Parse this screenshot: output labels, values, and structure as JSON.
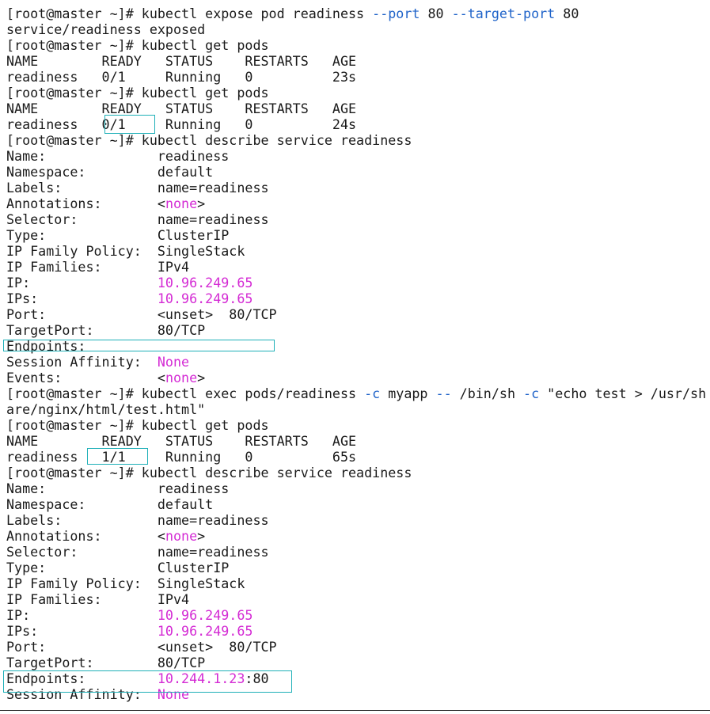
{
  "terminal": {
    "prompt": "[root@master ~]# ",
    "lines": [
      {
        "segments": [
          {
            "t": "[root@master ~]# kubectl expose pod readiness ",
            "c": ""
          },
          {
            "t": "--port",
            "c": "flag"
          },
          {
            "t": " 80 ",
            "c": ""
          },
          {
            "t": "--target-port",
            "c": "flag"
          },
          {
            "t": " 80",
            "c": ""
          }
        ]
      },
      {
        "segments": [
          {
            "t": "service/readiness exposed",
            "c": ""
          }
        ]
      },
      {
        "segments": [
          {
            "t": "[root@master ~]# kubectl get pods",
            "c": ""
          }
        ]
      },
      {
        "segments": [
          {
            "t": "NAME        READY   STATUS    RESTARTS   AGE",
            "c": ""
          }
        ]
      },
      {
        "segments": [
          {
            "t": "readiness   0/1     Running   0          23s",
            "c": ""
          }
        ]
      },
      {
        "segments": [
          {
            "t": "[root@master ~]# kubectl get pods",
            "c": ""
          }
        ]
      },
      {
        "segments": [
          {
            "t": "NAME        READY   STATUS    RESTARTS   AGE",
            "c": ""
          }
        ]
      },
      {
        "segments": [
          {
            "t": "readiness   0/1     Running   0          24s",
            "c": ""
          }
        ]
      },
      {
        "segments": [
          {
            "t": "[root@master ~]# kubectl describe service readiness",
            "c": ""
          }
        ]
      },
      {
        "segments": [
          {
            "t": "Name:              readiness",
            "c": ""
          }
        ]
      },
      {
        "segments": [
          {
            "t": "Namespace:         default",
            "c": ""
          }
        ]
      },
      {
        "segments": [
          {
            "t": "Labels:            name=readiness",
            "c": ""
          }
        ]
      },
      {
        "segments": [
          {
            "t": "Annotations:       <",
            "c": ""
          },
          {
            "t": "none",
            "c": "mag"
          },
          {
            "t": ">",
            "c": ""
          }
        ]
      },
      {
        "segments": [
          {
            "t": "Selector:          name=readiness",
            "c": ""
          }
        ]
      },
      {
        "segments": [
          {
            "t": "Type:              ClusterIP",
            "c": ""
          }
        ]
      },
      {
        "segments": [
          {
            "t": "IP Family Policy:  SingleStack",
            "c": ""
          }
        ]
      },
      {
        "segments": [
          {
            "t": "IP Families:       IPv4",
            "c": ""
          }
        ]
      },
      {
        "segments": [
          {
            "t": "IP:                ",
            "c": ""
          },
          {
            "t": "10.96.249.65",
            "c": "mag"
          }
        ]
      },
      {
        "segments": [
          {
            "t": "IPs:               ",
            "c": ""
          },
          {
            "t": "10.96.249.65",
            "c": "mag"
          }
        ]
      },
      {
        "segments": [
          {
            "t": "Port:              <unset>  80/TCP",
            "c": ""
          }
        ]
      },
      {
        "segments": [
          {
            "t": "TargetPort:        80/TCP",
            "c": ""
          }
        ]
      },
      {
        "segments": [
          {
            "t": "Endpoints:",
            "c": ""
          }
        ]
      },
      {
        "segments": [
          {
            "t": "Session Affinity:  ",
            "c": ""
          },
          {
            "t": "None",
            "c": "mag"
          }
        ]
      },
      {
        "segments": [
          {
            "t": "Events:            <",
            "c": ""
          },
          {
            "t": "none",
            "c": "mag"
          },
          {
            "t": ">",
            "c": ""
          }
        ]
      },
      {
        "segments": [
          {
            "t": "[root@master ~]# kubectl exec pods/readiness ",
            "c": ""
          },
          {
            "t": "-c",
            "c": "flag"
          },
          {
            "t": " myapp ",
            "c": ""
          },
          {
            "t": "--",
            "c": "flag"
          },
          {
            "t": " /bin/sh ",
            "c": ""
          },
          {
            "t": "-c",
            "c": "flag"
          },
          {
            "t": " \"echo test > /usr/sh",
            "c": ""
          }
        ]
      },
      {
        "segments": [
          {
            "t": "are/nginx/html/test.html\"",
            "c": ""
          }
        ]
      },
      {
        "segments": [
          {
            "t": "[root@master ~]# kubectl get pods",
            "c": ""
          }
        ]
      },
      {
        "segments": [
          {
            "t": "NAME        READY   STATUS    RESTARTS   AGE",
            "c": ""
          }
        ]
      },
      {
        "segments": [
          {
            "t": "readiness   1/1     Running   0          65s",
            "c": ""
          }
        ]
      },
      {
        "segments": [
          {
            "t": "[root@master ~]# kubectl describe service readiness",
            "c": ""
          }
        ]
      },
      {
        "segments": [
          {
            "t": "Name:              readiness",
            "c": ""
          }
        ]
      },
      {
        "segments": [
          {
            "t": "Namespace:         default",
            "c": ""
          }
        ]
      },
      {
        "segments": [
          {
            "t": "Labels:            name=readiness",
            "c": ""
          }
        ]
      },
      {
        "segments": [
          {
            "t": "Annotations:       <",
            "c": ""
          },
          {
            "t": "none",
            "c": "mag"
          },
          {
            "t": ">",
            "c": ""
          }
        ]
      },
      {
        "segments": [
          {
            "t": "Selector:          name=readiness",
            "c": ""
          }
        ]
      },
      {
        "segments": [
          {
            "t": "Type:              ClusterIP",
            "c": ""
          }
        ]
      },
      {
        "segments": [
          {
            "t": "IP Family Policy:  SingleStack",
            "c": ""
          }
        ]
      },
      {
        "segments": [
          {
            "t": "IP Families:       IPv4",
            "c": ""
          }
        ]
      },
      {
        "segments": [
          {
            "t": "IP:                ",
            "c": ""
          },
          {
            "t": "10.96.249.65",
            "c": "mag"
          }
        ]
      },
      {
        "segments": [
          {
            "t": "IPs:               ",
            "c": ""
          },
          {
            "t": "10.96.249.65",
            "c": "mag"
          }
        ]
      },
      {
        "segments": [
          {
            "t": "Port:              <unset>  80/TCP",
            "c": ""
          }
        ]
      },
      {
        "segments": [
          {
            "t": "TargetPort:        80/TCP",
            "c": ""
          }
        ]
      },
      {
        "segments": [
          {
            "t": "Endpoints:         ",
            "c": ""
          },
          {
            "t": "10.244.1.23",
            "c": "mag"
          },
          {
            "t": ":80",
            "c": ""
          }
        ]
      },
      {
        "segments": [
          {
            "t": "Session Affinity:  ",
            "c": ""
          },
          {
            "t": "None",
            "c": "mag"
          }
        ]
      }
    ]
  },
  "colors": {
    "background": "#ffffff",
    "text": "#1a1a1a",
    "flag": "#1f63c9",
    "magenta": "#d42bd4",
    "highlight_box": "#1fb0b8"
  }
}
